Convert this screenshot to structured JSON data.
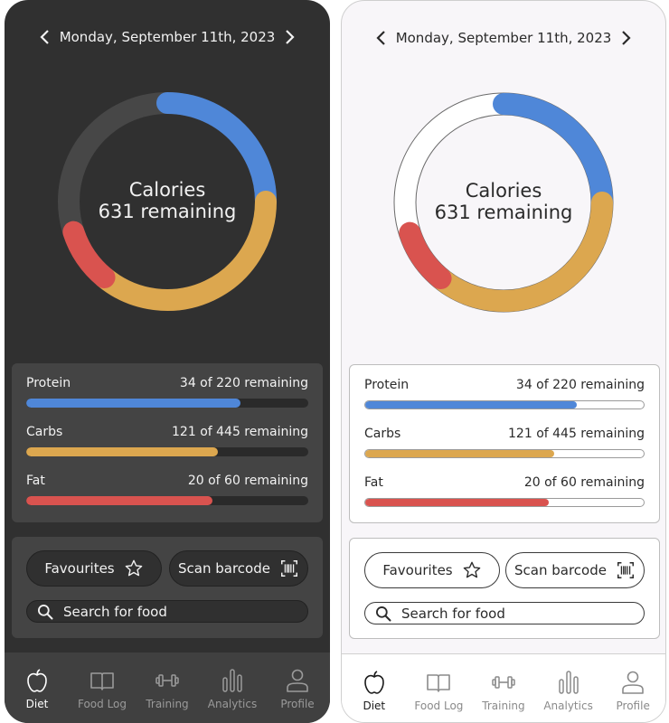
{
  "date": "Monday, September 11th, 2023",
  "calories": {
    "title": "Calories",
    "remaining": "631 remaining"
  },
  "ring_segments": [
    {
      "name": "protein",
      "color": "#4f87d8",
      "fraction": 0.25
    },
    {
      "name": "carbs",
      "color": "#dca74f",
      "fraction": 0.36
    },
    {
      "name": "fat",
      "color": "#d9534f",
      "fraction": 0.09
    }
  ],
  "macros": [
    {
      "label": "Protein",
      "value": "34 of 220 remaining",
      "color": "#4f87d8",
      "fraction": 0.76
    },
    {
      "label": "Carbs",
      "value": "121 of 445 remaining",
      "color": "#dca74f",
      "fraction": 0.68
    },
    {
      "label": "Fat",
      "value": "20 of 60 remaining",
      "color": "#d9534f",
      "fraction": 0.66
    }
  ],
  "actions": {
    "favourites": "Favourites",
    "favourites_icon": "star-icon",
    "scan": "Scan barcode",
    "scan_icon": "barcode-icon",
    "search_placeholder": "Search for food",
    "search_icon": "search-icon"
  },
  "tabs": [
    {
      "label": "Diet",
      "icon": "apple-icon",
      "active": true
    },
    {
      "label": "Food Log",
      "icon": "book-icon",
      "active": false
    },
    {
      "label": "Training",
      "icon": "dumbbell-icon",
      "active": false
    },
    {
      "label": "Analytics",
      "icon": "bar-chart-icon",
      "active": false
    },
    {
      "label": "Profile",
      "icon": "user-icon",
      "active": false
    }
  ]
}
